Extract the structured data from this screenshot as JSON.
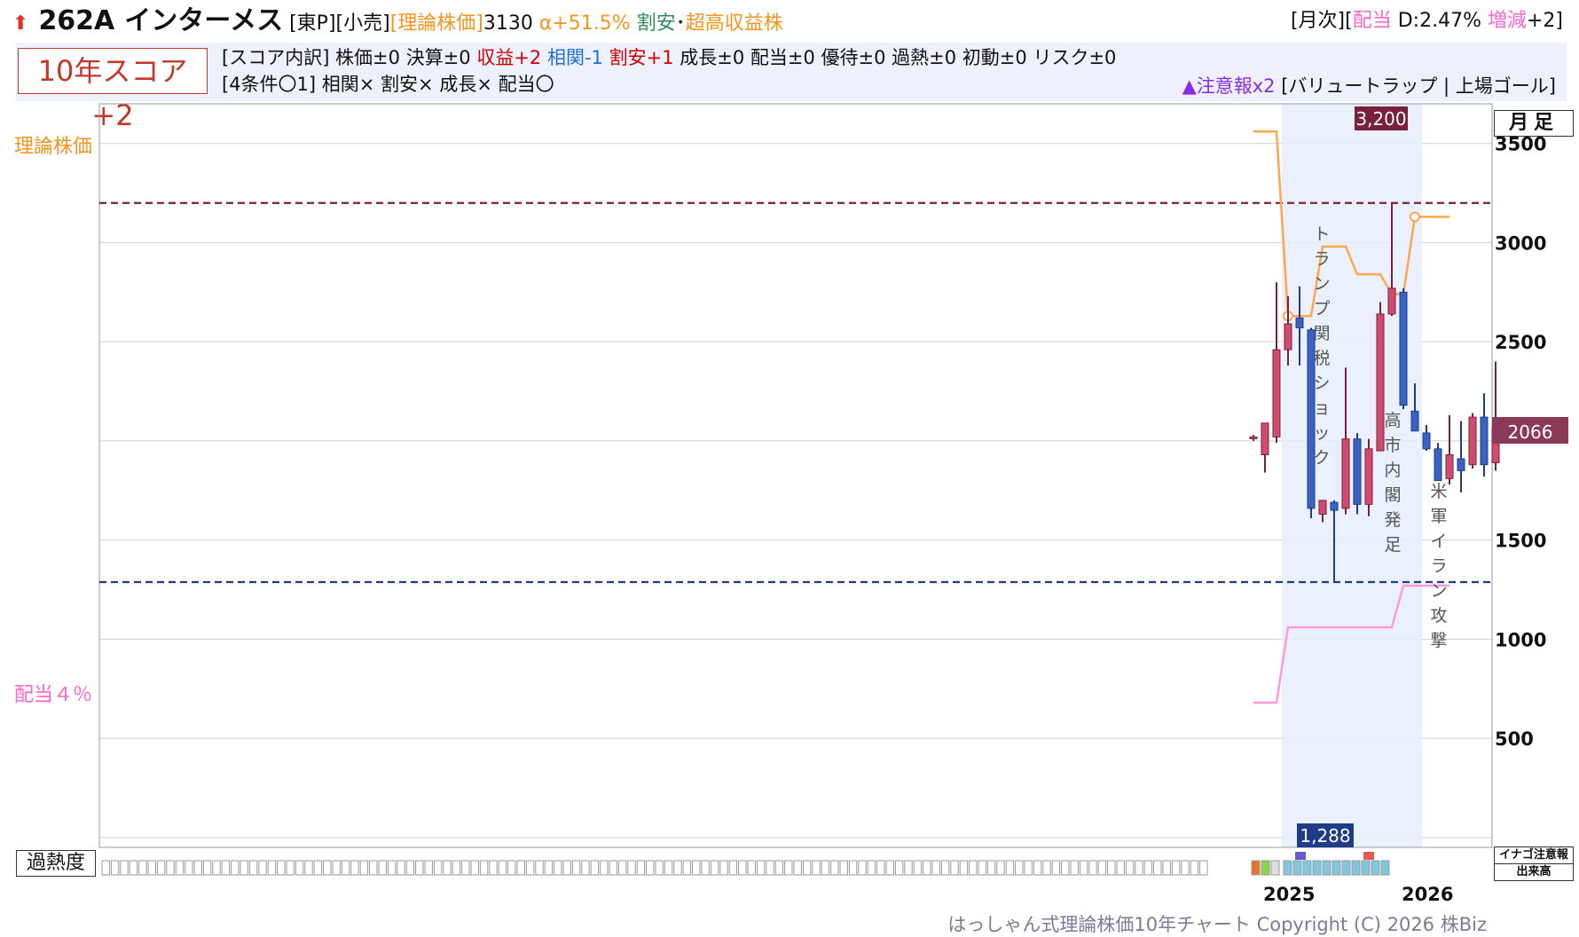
{
  "header": {
    "code": "262A",
    "name": "インターメス",
    "market_tag": "[東P]",
    "sector_tag": "[小売]",
    "theory_price_tag": "[理論株価]",
    "theory_price_value": "3130",
    "alpha": "α+51.5%",
    "cheap_label": "割安",
    "separator": "･",
    "high_yield_label": "超高収益株",
    "right_prefix": "[月次][",
    "dividend_label": "配当",
    "dividend_value": " D:2.47% ",
    "change_label": "増減",
    "change_value": "+2]",
    "colors": {
      "theory": "#f7941d",
      "cheap": "#2e8b57",
      "pink": "#ff66cc",
      "red": "#cc0000",
      "blue": "#1e6fd9"
    }
  },
  "score": {
    "box_label": "10年スコア+2",
    "line1_prefix": "[スコア内訳] 株価±0 決算±0 ",
    "line1_profit": "収益+2",
    "line1_corr": "相関-1",
    "line1_cheap": "割安+1",
    "line1_rest": "成長±0 配当±0 優待±0 過熱±0 初動±0 リスク±0",
    "line2": "[4条件〇1] 相関× 割安× 成長× 配当〇",
    "warning_prefix": "▲注意報x2 ",
    "warning_text": "[バリュートラップ | 上場ゴール]"
  },
  "labels": {
    "theory_price": "理論株価",
    "dividend_4": "配当４％",
    "monthly": "月足",
    "overheat": "過熱度",
    "legend_top": "イナゴ注意報",
    "legend_bottom": "出来高",
    "copyright": "はっしゃん式理論株価10年チャート Copyright (C) 2026 株Biz",
    "year_2025": "2025",
    "year_2026": "2026",
    "current_price": "2066",
    "high_marker": "3,200",
    "low_marker": "1,288"
  },
  "chart_data": {
    "type": "candlestick",
    "period": "monthly",
    "y_ticks": [
      500,
      1000,
      1500,
      2000,
      2500,
      3000,
      3500
    ],
    "y_tick_labels": [
      "500",
      "1000",
      "1500",
      "",
      "2500",
      "3000",
      "3500"
    ],
    "y_range": [
      -50,
      3700
    ],
    "x_ticks": [
      "2025",
      "2026"
    ],
    "candles": [
      {
        "open": 2020,
        "high": 2030,
        "low": 2000,
        "close": 2020,
        "dir": "flat"
      },
      {
        "open": 1930,
        "high": 2090,
        "low": 1840,
        "close": 2090,
        "dir": "up"
      },
      {
        "open": 2020,
        "high": 2800,
        "low": 1990,
        "close": 2460,
        "dir": "up"
      },
      {
        "open": 2460,
        "high": 2730,
        "low": 2380,
        "close": 2590,
        "dir": "up"
      },
      {
        "open": 2570,
        "high": 2780,
        "low": 2380,
        "close": 2620,
        "dir": "down"
      },
      {
        "open": 2560,
        "high": 2570,
        "low": 1610,
        "close": 1660,
        "dir": "down"
      },
      {
        "open": 1630,
        "high": 1700,
        "low": 1590,
        "close": 1700,
        "dir": "up"
      },
      {
        "open": 1690,
        "high": 1700,
        "low": 1288,
        "close": 1650,
        "dir": "down"
      },
      {
        "open": 1660,
        "high": 2370,
        "low": 1630,
        "close": 2010,
        "dir": "up"
      },
      {
        "open": 2010,
        "high": 2040,
        "low": 1630,
        "close": 1680,
        "dir": "down"
      },
      {
        "open": 1680,
        "high": 2010,
        "low": 1620,
        "close": 1960,
        "dir": "up"
      },
      {
        "open": 1950,
        "high": 2700,
        "low": 1950,
        "close": 2640,
        "dir": "up"
      },
      {
        "open": 2640,
        "high": 3200,
        "low": 2630,
        "close": 2770,
        "dir": "up"
      },
      {
        "open": 2750,
        "high": 2770,
        "low": 2160,
        "close": 2180,
        "dir": "down"
      },
      {
        "open": 2150,
        "high": 2290,
        "low": 2060,
        "close": 2050,
        "dir": "down"
      },
      {
        "open": 2040,
        "high": 2080,
        "low": 1950,
        "close": 1960,
        "dir": "down"
      },
      {
        "open": 1960,
        "high": 1990,
        "low": 1800,
        "close": 1800,
        "dir": "down"
      },
      {
        "open": 1810,
        "high": 2130,
        "low": 1780,
        "close": 1930,
        "dir": "up"
      },
      {
        "open": 1910,
        "high": 2100,
        "low": 1740,
        "close": 1850,
        "dir": "down"
      },
      {
        "open": 1880,
        "high": 2140,
        "low": 1860,
        "close": 2120,
        "dir": "up"
      },
      {
        "open": 2120,
        "high": 2240,
        "low": 1820,
        "close": 1880,
        "dir": "down"
      },
      {
        "open": 1890,
        "high": 2400,
        "low": 1850,
        "close": 2066,
        "dir": "up"
      }
    ],
    "theory_price_line": [
      3560,
      3560,
      3560,
      2630,
      2630,
      2630,
      2980,
      2980,
      2980,
      2840,
      2840,
      2840,
      2740,
      2740,
      3130,
      3130,
      3130,
      3130
    ],
    "dividend_4pct_line": [
      680,
      680,
      680,
      1060,
      1060,
      1060,
      1060,
      1060,
      1060,
      1060,
      1060,
      1060,
      1060,
      1270,
      1270,
      1270,
      1270,
      1270
    ],
    "high_line": 3200,
    "low_line": 1288,
    "annotations": [
      {
        "text": "トランプ関税ショック",
        "at_value": 2150
      },
      {
        "text": "高市内閣発足",
        "at_value": 1620
      },
      {
        "text": "米軍イラン攻撃",
        "at_value": 1150
      }
    ],
    "colors": {
      "up": "#d14b6e",
      "down": "#3a62c4",
      "high": "#7a1f3d",
      "low": "#1f3c88",
      "theory": "#ffa64d",
      "dividend": "#ff99dd",
      "grid": "#cfcfcf"
    }
  }
}
